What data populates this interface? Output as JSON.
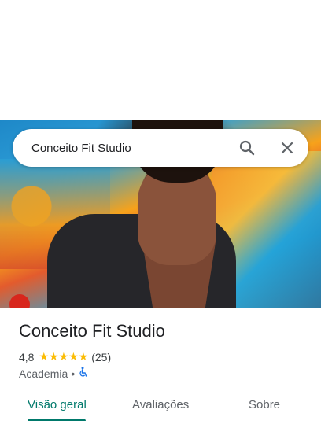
{
  "search": {
    "query": "Conceito Fit Studio"
  },
  "place": {
    "name": "Conceito Fit Studio",
    "rating": "4,8",
    "stars": "★★★★★",
    "review_count": "(25)",
    "category": "Academia",
    "separator": "•"
  },
  "tabs": [
    {
      "label": "Visão geral",
      "active": true
    },
    {
      "label": "Avaliações",
      "active": false
    },
    {
      "label": "Sobre",
      "active": false
    }
  ],
  "colors": {
    "accent": "#00796b",
    "star": "#fbbc04",
    "accessibility": "#1a73e8"
  },
  "icons": {
    "search": "search-icon",
    "close": "close-icon",
    "accessibility": "wheelchair-icon"
  }
}
